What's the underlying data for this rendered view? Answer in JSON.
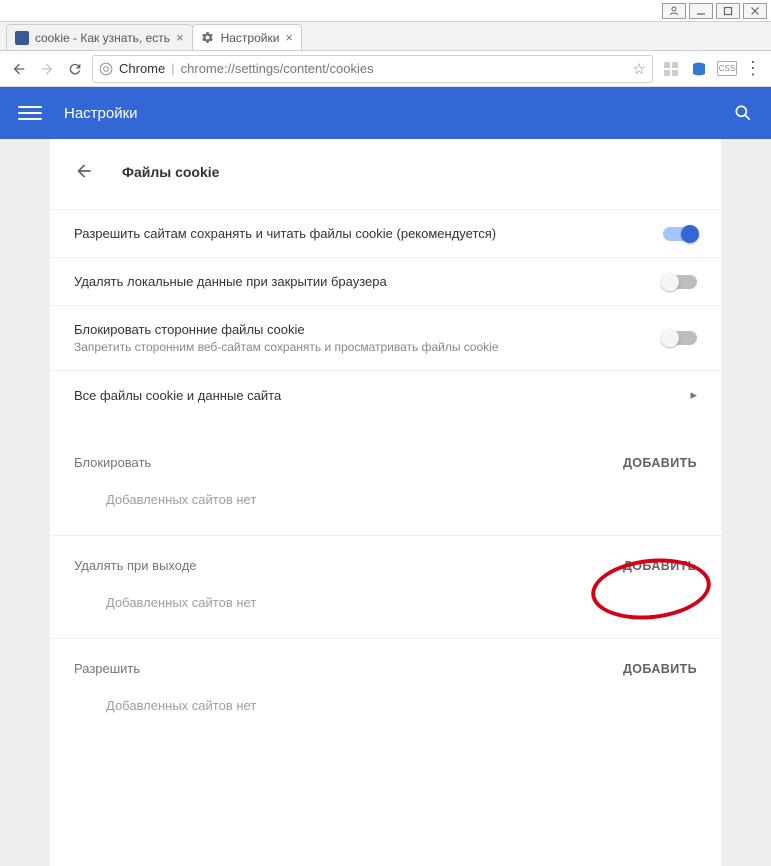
{
  "window": {
    "buttons": [
      "user",
      "min",
      "max",
      "close"
    ]
  },
  "tabs": [
    {
      "label": "cookie - Как узнать, есть",
      "active": false,
      "favicon": "stack"
    },
    {
      "label": "Настройки",
      "active": true,
      "favicon": "gear"
    }
  ],
  "addressbar": {
    "label": "Chrome",
    "url": "chrome://settings/content/cookies",
    "css_badge": "CSS"
  },
  "header": {
    "title": "Настройки"
  },
  "page": {
    "title": "Файлы cookie"
  },
  "options": [
    {
      "label": "Разрешить сайтам сохранять и читать файлы cookie (рекомендуется)",
      "sub": "",
      "control": "switch",
      "state": "on"
    },
    {
      "label": "Удалять локальные данные при закрытии браузера",
      "sub": "",
      "control": "switch",
      "state": "off"
    },
    {
      "label": "Блокировать сторонние файлы cookie",
      "sub": "Запретить сторонним веб-сайтам сохранять и просматривать файлы cookie",
      "control": "switch",
      "state": "off"
    },
    {
      "label": "Все файлы cookie и данные сайта",
      "sub": "",
      "control": "arrow",
      "state": ""
    }
  ],
  "sections": [
    {
      "title": "Блокировать",
      "add": "ДОБАВИТЬ",
      "empty": "Добавленных сайтов нет"
    },
    {
      "title": "Удалять при выходе",
      "add": "ДОБАВИТЬ",
      "empty": "Добавленных сайтов нет"
    },
    {
      "title": "Разрешить",
      "add": "ДОБАВИТЬ",
      "empty": "Добавленных сайтов нет"
    }
  ]
}
